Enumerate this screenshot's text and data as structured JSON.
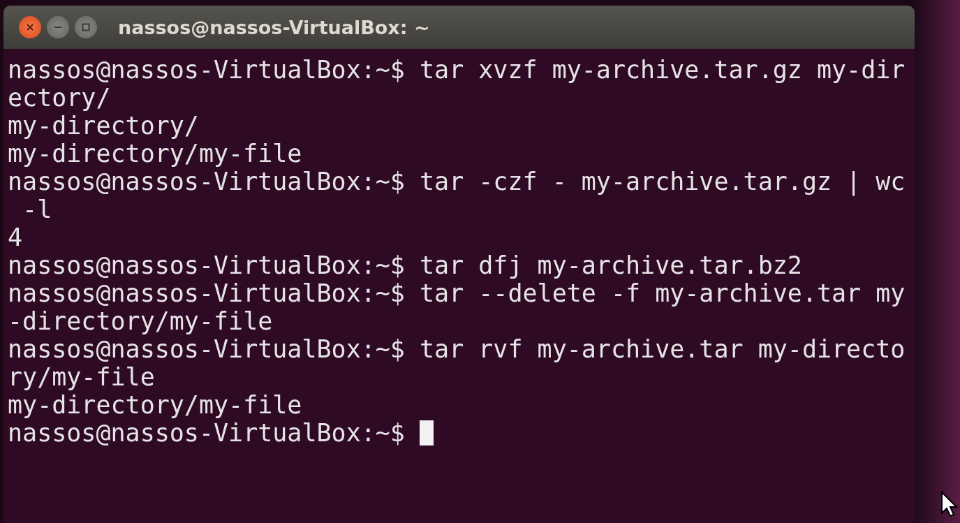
{
  "window": {
    "title": "nassos@nassos-VirtualBox: ~"
  },
  "terminal": {
    "lines": [
      "nassos@nassos-VirtualBox:~$ tar xvzf my-archive.tar.gz my-dir",
      "ectory/",
      "my-directory/",
      "my-directory/my-file",
      "nassos@nassos-VirtualBox:~$ tar -czf - my-archive.tar.gz | wc",
      " -l",
      "4",
      "nassos@nassos-VirtualBox:~$ tar dfj my-archive.tar.bz2",
      "nassos@nassos-VirtualBox:~$ tar --delete -f my-archive.tar my",
      "-directory/my-file",
      "nassos@nassos-VirtualBox:~$ tar rvf my-archive.tar my-directo",
      "ry/my-file",
      "my-directory/my-file",
      "nassos@nassos-VirtualBox:~$ "
    ],
    "cursor": true
  }
}
